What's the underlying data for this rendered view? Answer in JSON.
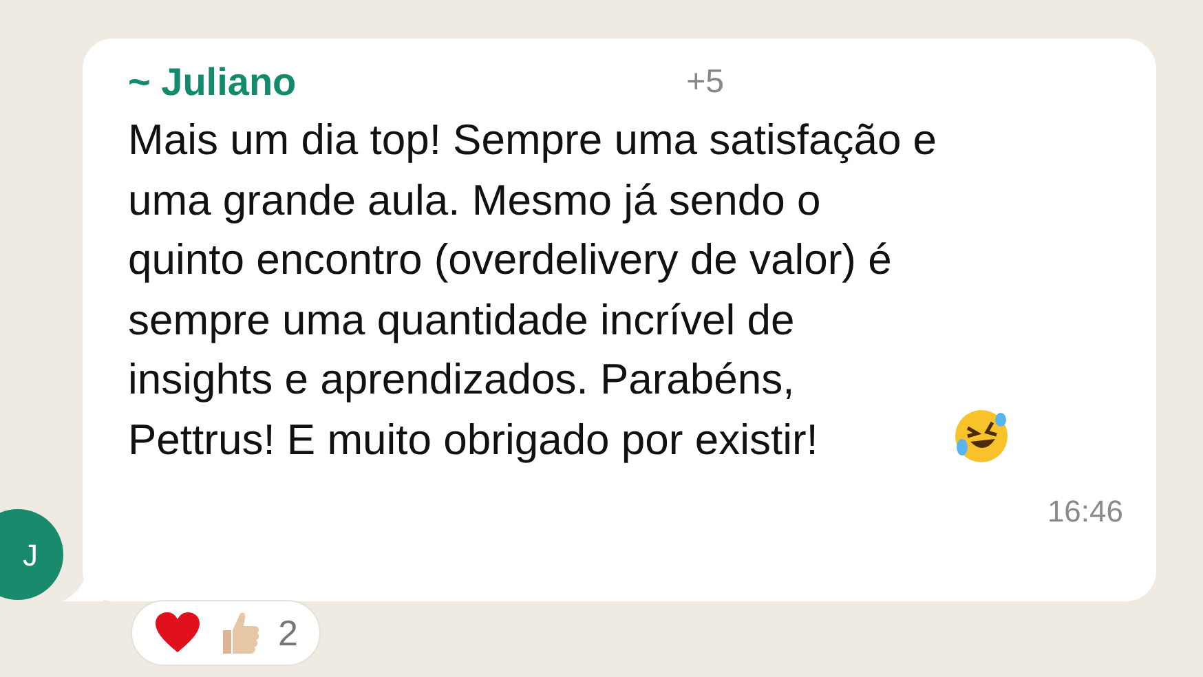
{
  "message": {
    "sender": "~ Juliano",
    "phone": "+5",
    "lines": [
      "Mais um dia top! Sempre uma satisfação e",
      "uma grande aula. Mesmo já sendo o",
      "quinto encontro (overdelivery de valor) é",
      "sempre uma quantidade incrível de",
      "insights e aprendizados. Parabéns,",
      "Pettrus! E muito obrigado por existir!"
    ],
    "time": "16:46",
    "avatar": "J",
    "reaction_count": "2"
  }
}
